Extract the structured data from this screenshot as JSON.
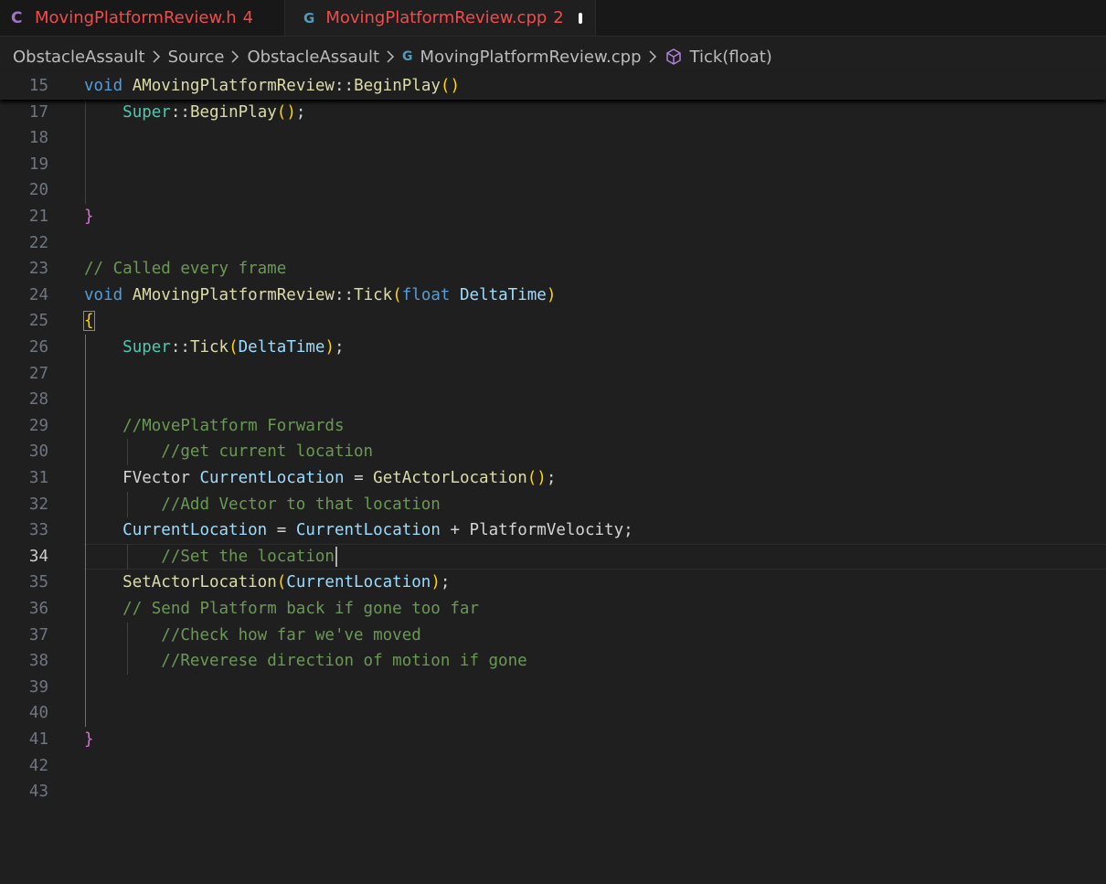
{
  "tabs": [
    {
      "icon": "C",
      "filename": "MovingPlatformReview.h",
      "problems": "4",
      "active": false
    },
    {
      "icon": "G",
      "filename": "MovingPlatformReview.cpp",
      "problems": "2",
      "active": true
    }
  ],
  "breadcrumb": {
    "items": [
      "ObstacleAssault",
      "Source",
      "ObstacleAssault",
      "MovingPlatformReview.cpp",
      "Tick(float)"
    ]
  },
  "editor": {
    "current_line": "34",
    "lines": [
      {
        "n": "15",
        "text": "void AMovingPlatformReview::BeginPlay()"
      },
      {
        "n": "17",
        "text": "    Super::BeginPlay();"
      },
      {
        "n": "18",
        "text": ""
      },
      {
        "n": "19",
        "text": ""
      },
      {
        "n": "20",
        "text": ""
      },
      {
        "n": "21",
        "text": "}"
      },
      {
        "n": "22",
        "text": ""
      },
      {
        "n": "23",
        "text": "// Called every frame"
      },
      {
        "n": "24",
        "text": "void AMovingPlatformReview::Tick(float DeltaTime)"
      },
      {
        "n": "25",
        "text": "{"
      },
      {
        "n": "26",
        "text": "    Super::Tick(DeltaTime);"
      },
      {
        "n": "27",
        "text": ""
      },
      {
        "n": "28",
        "text": ""
      },
      {
        "n": "29",
        "text": "    //MovePlatform Forwards"
      },
      {
        "n": "30",
        "text": "        //get current location"
      },
      {
        "n": "31",
        "text": "    FVector CurrentLocation = GetActorLocation();"
      },
      {
        "n": "32",
        "text": "        //Add Vector to that location"
      },
      {
        "n": "33",
        "text": "    CurrentLocation = CurrentLocation + PlatformVelocity;"
      },
      {
        "n": "34",
        "text": "        //Set the location"
      },
      {
        "n": "35",
        "text": "    SetActorLocation(CurrentLocation);"
      },
      {
        "n": "36",
        "text": "    // Send Platform back if gone too far"
      },
      {
        "n": "37",
        "text": "        //Check how far we've moved"
      },
      {
        "n": "38",
        "text": "        //Reverese direction of motion if gone"
      },
      {
        "n": "39",
        "text": ""
      },
      {
        "n": "40",
        "text": ""
      },
      {
        "n": "41",
        "text": "}"
      },
      {
        "n": "42",
        "text": ""
      },
      {
        "n": "43",
        "text": ""
      }
    ]
  },
  "colors": {
    "keyword": "#569cd6",
    "class": "#4ec9b0",
    "function": "#dcdcaa",
    "variable": "#9cdcfe",
    "comment": "#6a9955",
    "bracket_level1": "#ffd700",
    "bracket_level2": "#da70d6",
    "tab_modified": "#f14c4c"
  }
}
